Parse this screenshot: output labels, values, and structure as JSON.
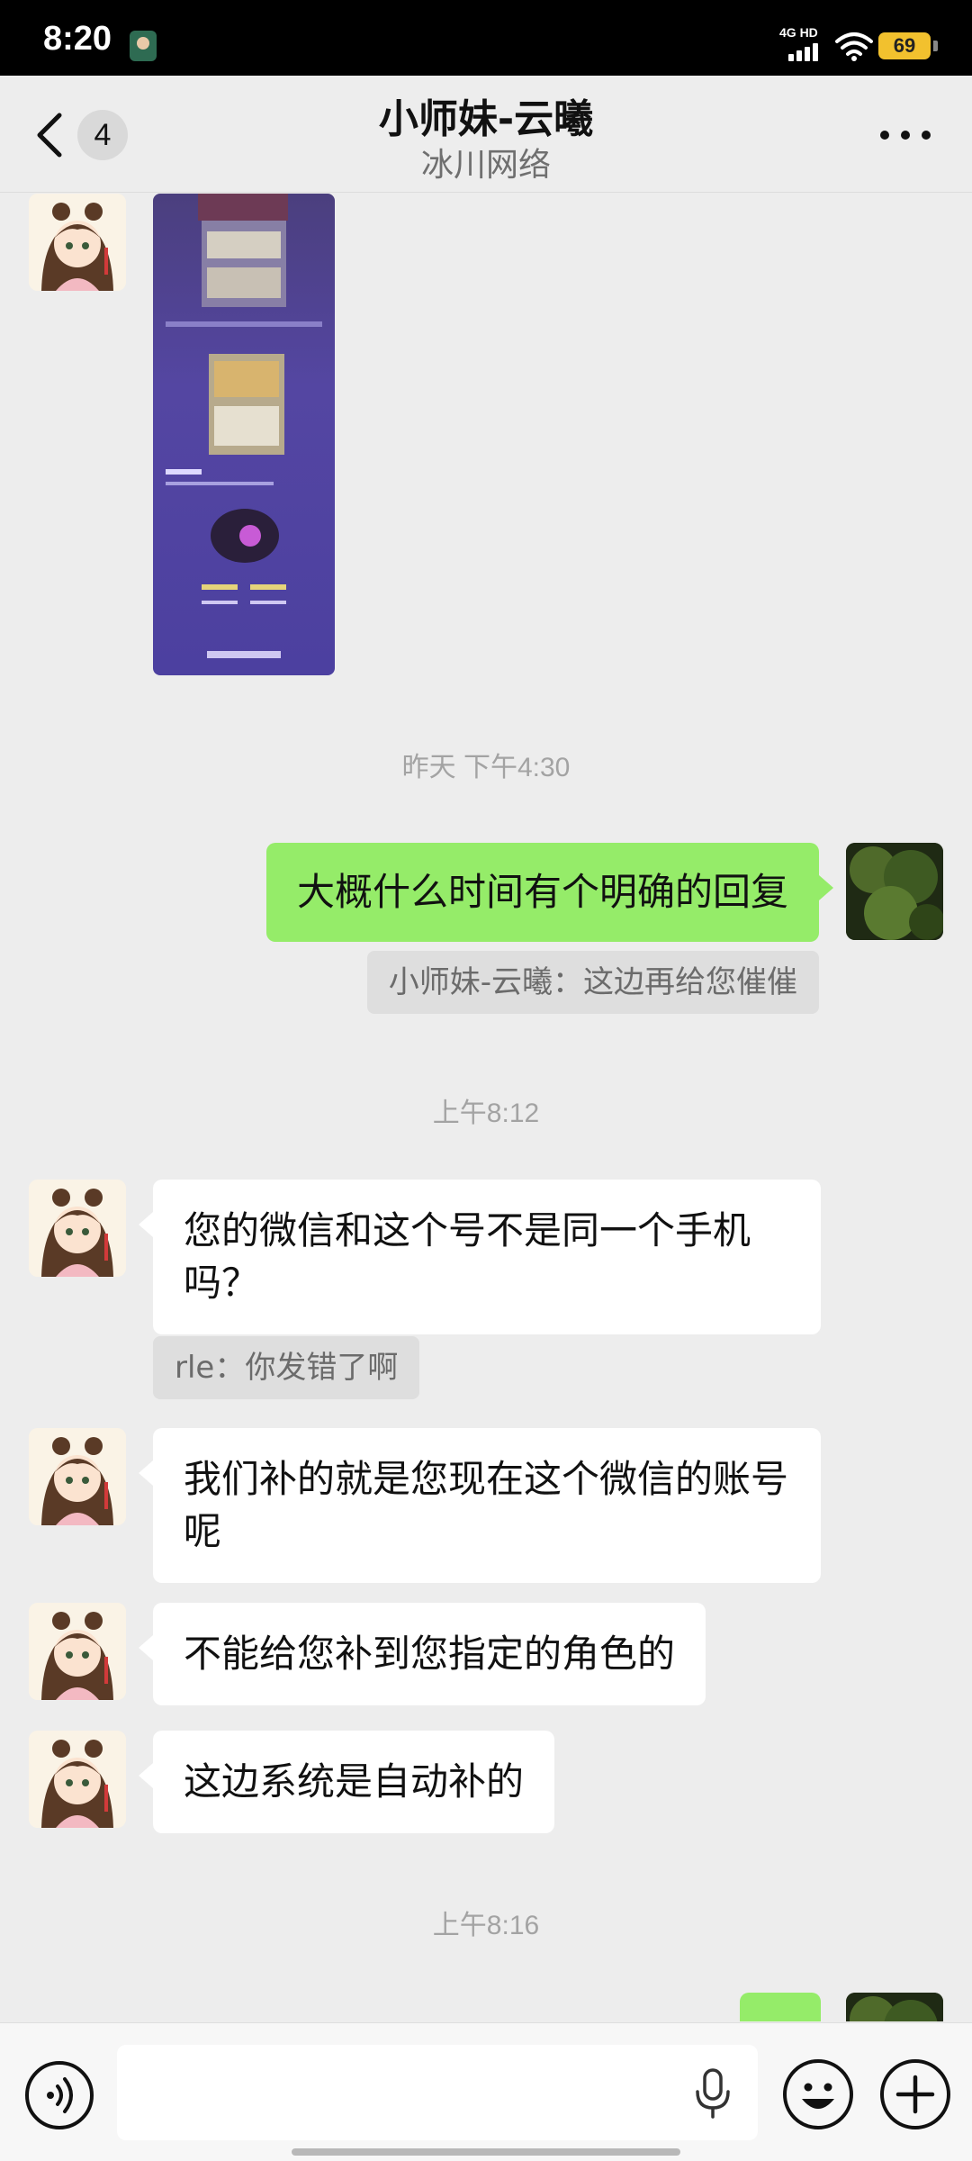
{
  "status_bar": {
    "time": "8:20",
    "network": "4G HD",
    "battery": "69"
  },
  "header": {
    "unread_count": "4",
    "title": "小师妹-云曦",
    "subtitle": "冰川网络"
  },
  "messages": {
    "ts1": "昨天 下午4:30",
    "out1": "大概什么时间有个明确的回复",
    "quote1": "小师妹-云曦：这边再给您催催",
    "ts2": "上午8:12",
    "in1": "您的微信和这个号不是同一个手机吗？",
    "quote2": "rle：你发错了啊",
    "in2": "我们补的就是您现在这个微信的账号呢",
    "in3": "不能给您补到您指定的角色的",
    "in4": "这边系统是自动补的",
    "ts3": "上午8:16"
  },
  "input": {
    "value": ""
  },
  "colors": {
    "outgoing_bubble": "#95ec69",
    "incoming_bubble": "#ffffff",
    "background": "#ededed"
  },
  "icons": [
    "back-arrow-icon",
    "more-icon",
    "voice-icon",
    "microphone-icon",
    "emoji-icon",
    "plus-icon"
  ]
}
